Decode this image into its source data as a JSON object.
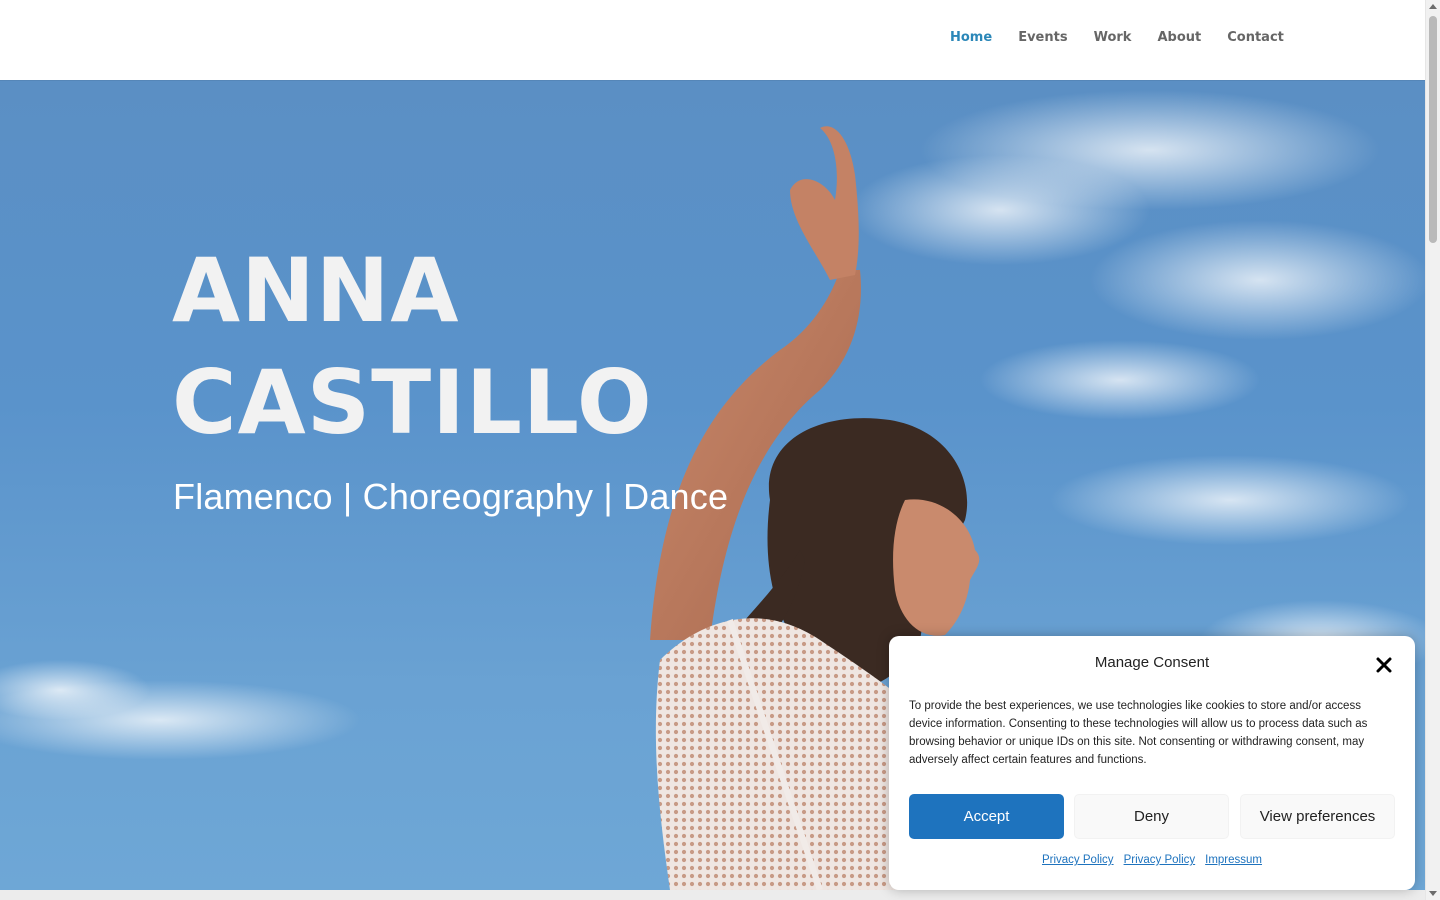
{
  "nav": {
    "items": [
      {
        "label": "Home",
        "active": true
      },
      {
        "label": "Events",
        "active": false
      },
      {
        "label": "Work",
        "active": false
      },
      {
        "label": "About",
        "active": false
      },
      {
        "label": "Contact",
        "active": false
      }
    ]
  },
  "hero": {
    "title_line1": "ANNA",
    "title_line2": "CASTILLO",
    "subtitle": "Flamenco | Choreography | Dance"
  },
  "consent": {
    "title": "Manage Consent",
    "text": "To provide the best experiences, we use technologies like cookies to store and/or access device information. Consenting to these technologies will allow us to process data such as browsing behavior or unique IDs on this site. Not consenting or withdrawing consent, may adversely affect certain features and functions.",
    "accept_label": "Accept",
    "deny_label": "Deny",
    "prefs_label": "View preferences",
    "links": [
      "Privacy Policy",
      "Privacy Policy",
      "Impressum"
    ]
  },
  "colors": {
    "accent": "#2b87b8",
    "button_primary": "#1e73be",
    "sky": "#5a93cb"
  }
}
